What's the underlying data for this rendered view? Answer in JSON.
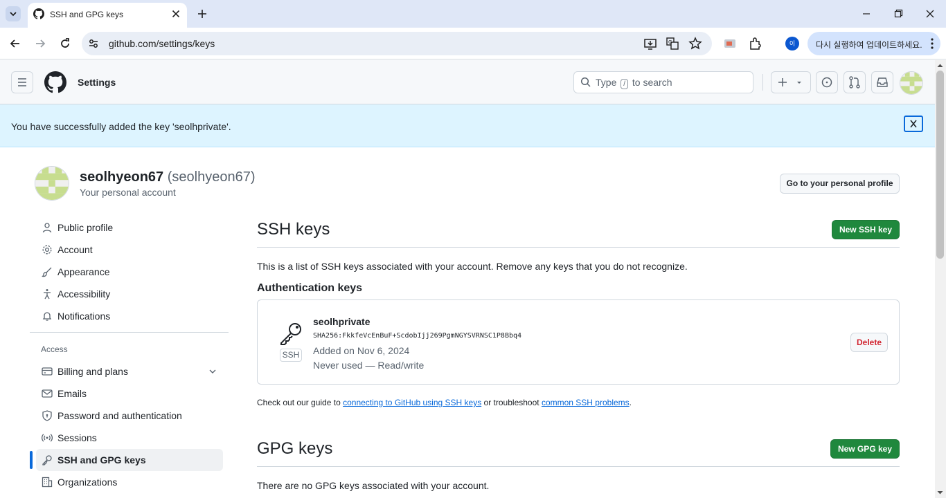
{
  "browser": {
    "tab_title": "SSH and GPG keys",
    "url": "github.com/settings/keys",
    "update_label": "다시 실행하여 업데이트하세요.",
    "profile_initial": "이"
  },
  "header": {
    "title": "Settings",
    "search_prefix": "Type",
    "search_key": "/",
    "search_suffix": "to search"
  },
  "flash": {
    "message": "You have successfully added the key 'seolhprivate'."
  },
  "profile": {
    "name": "seolhyeon67",
    "login": "(seolhyeon67)",
    "subtitle": "Your personal account",
    "go_profile_label": "Go to your personal profile"
  },
  "sidebar": {
    "items": [
      {
        "label": "Public profile"
      },
      {
        "label": "Account"
      },
      {
        "label": "Appearance"
      },
      {
        "label": "Accessibility"
      },
      {
        "label": "Notifications"
      }
    ],
    "access_heading": "Access",
    "access_items": [
      {
        "label": "Billing and plans"
      },
      {
        "label": "Emails"
      },
      {
        "label": "Password and authentication"
      },
      {
        "label": "Sessions"
      },
      {
        "label": "SSH and GPG keys"
      },
      {
        "label": "Organizations"
      }
    ]
  },
  "ssh": {
    "heading": "SSH keys",
    "new_button": "New SSH key",
    "description": "This is a list of SSH keys associated with your account. Remove any keys that you do not recognize.",
    "auth_heading": "Authentication keys",
    "key": {
      "title": "seolhprivate",
      "fingerprint": "SHA256:FkkfeVcEnBuF+ScdobIjj269PgmNGYSVRNSC1P8Bbq4",
      "added": "Added on Nov 6, 2024",
      "usage": "Never used — Read/write",
      "type_label": "SSH",
      "delete_label": "Delete"
    },
    "guide_prefix": "Check out our guide to",
    "guide_link1": "connecting to GitHub using SSH keys",
    "guide_middle": "or troubleshoot",
    "guide_link2": "common SSH problems",
    "guide_suffix": "."
  },
  "gpg": {
    "heading": "GPG keys",
    "new_button": "New GPG key",
    "description": "There are no GPG keys associated with your account."
  }
}
